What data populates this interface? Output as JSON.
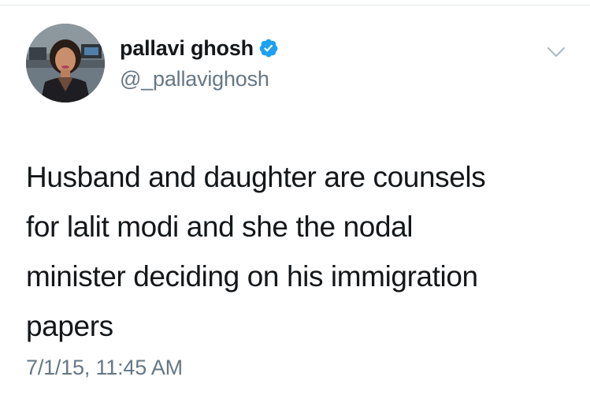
{
  "tweet": {
    "author": {
      "display_name": "pallavi ghosh",
      "handle": "@_pallavighosh",
      "verified": true,
      "avatar_icon": "profile-photo"
    },
    "menu_icon": "chevron-down-icon",
    "text": "Husband and daughter are counsels\nfor lalit modi and she the nodal\nminister deciding on his immigration\npapers",
    "timestamp": "7/1/15, 11:45 AM"
  },
  "colors": {
    "text_primary": "#14171a",
    "text_secondary": "#657786",
    "verified_blue": "#1da1f2",
    "chevron": "#aab8c2",
    "divider": "#e1e8ed"
  }
}
